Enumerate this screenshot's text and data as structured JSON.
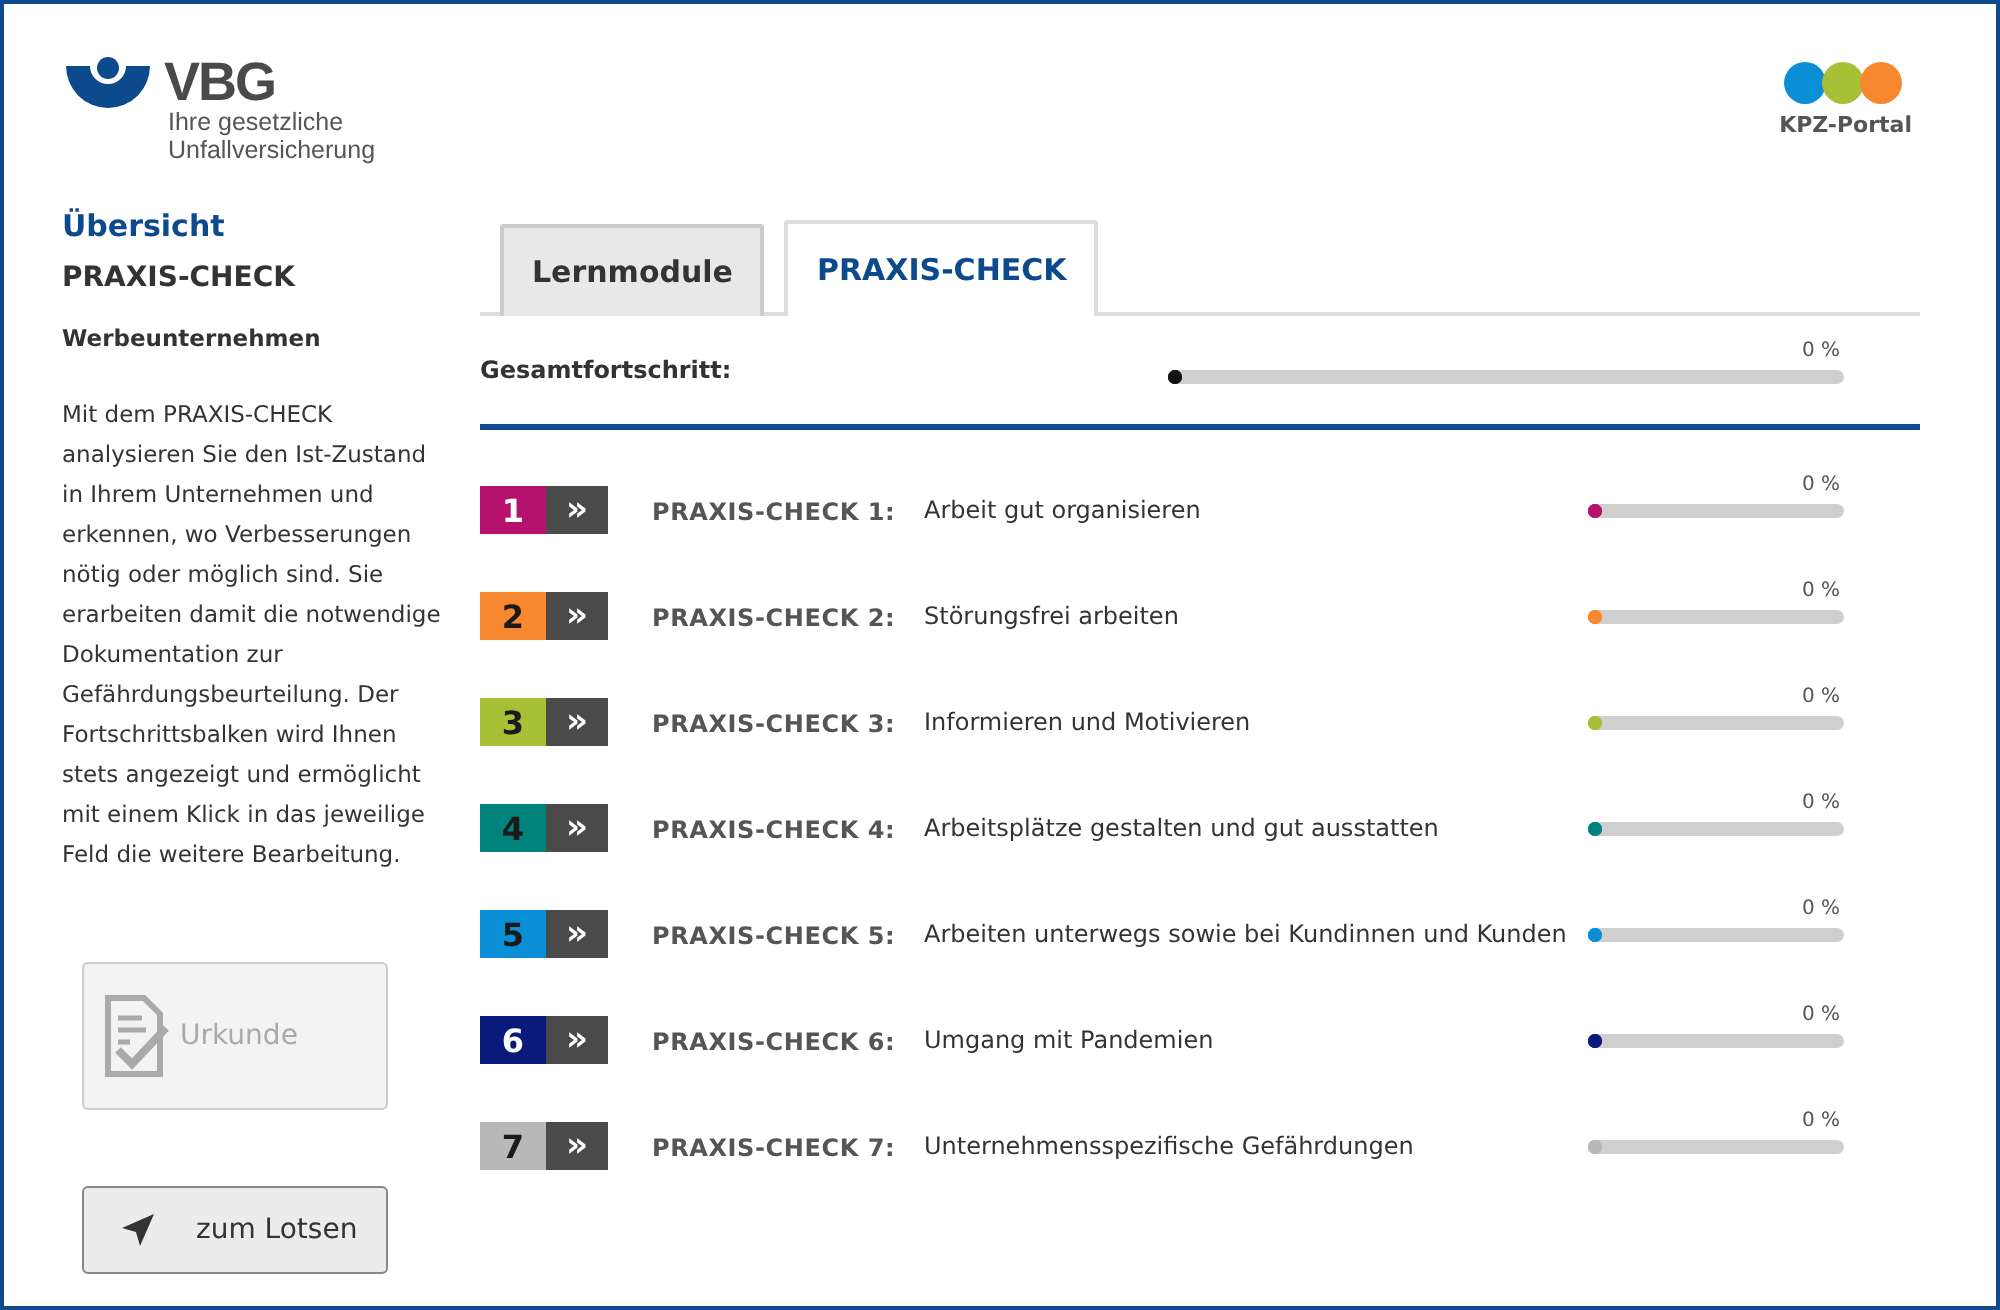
{
  "logo": {
    "name": "VBG",
    "tagline_1": "Ihre gesetzliche",
    "tagline_2": "Unfallversicherung"
  },
  "portal": {
    "label": "KPZ-Portal"
  },
  "sidebar": {
    "heading": "Übersicht",
    "title": "PRAXIS-CHECK",
    "subtitle": "Werbeunternehmen",
    "description": "Mit dem PRAXIS-CHECK analysieren Sie den Ist-Zustand in Ihrem Unternehmen und erkennen, wo Verbesserungen nötig oder möglich sind. Sie erarbeiten damit die notwendige Dokumentation zur Gefährdungsbeurteilung. Der Fortschrittsbalken wird Ihnen stets angezeigt und ermöglicht mit einem Klick in das jeweilige Feld die weitere Bearbeitung.",
    "buttons": [
      {
        "label": "Urkunde",
        "kind": "certificate",
        "disabled": true
      },
      {
        "label": "zum Lotsen",
        "kind": "navigate",
        "disabled": false
      }
    ]
  },
  "tabs": [
    {
      "label": "Lernmodule",
      "selected": false
    },
    {
      "label": "PRAXIS-CHECK",
      "selected": true
    }
  ],
  "overall": {
    "label": "Gesamtfortschritt:",
    "reading": "0 %",
    "level": 0
  },
  "checks": [
    {
      "number": "1",
      "arrow": "»",
      "title": "PRAXIS-CHECK 1:",
      "topic": "Arbeit gut organisieren",
      "reading": "0 %",
      "level": 0,
      "color": "#b5126e",
      "light_number": true
    },
    {
      "number": "2",
      "arrow": "»",
      "title": "PRAXIS-CHECK 2:",
      "topic": "Störungsfrei arbeiten",
      "reading": "0 %",
      "level": 0,
      "color": "#f7882f",
      "light_number": false
    },
    {
      "number": "3",
      "arrow": "»",
      "title": "PRAXIS-CHECK 3:",
      "topic": "Informieren und Motivieren",
      "reading": "0 %",
      "level": 0,
      "color": "#a8c035",
      "light_number": false
    },
    {
      "number": "4",
      "arrow": "»",
      "title": "PRAXIS-CHECK 4:",
      "topic": "Arbeitsplätze gestalten und gut ausstatten",
      "reading": "0 %",
      "level": 0,
      "color": "#00827d",
      "light_number": false
    },
    {
      "number": "5",
      "arrow": "»",
      "title": "PRAXIS-CHECK 5:",
      "topic": "Arbeiten unterwegs sowie bei Kundinnen und Kunden",
      "reading": "0 %",
      "level": 0,
      "color": "#0a8fd6",
      "light_number": false
    },
    {
      "number": "6",
      "arrow": "»",
      "title": "PRAXIS-CHECK 6:",
      "topic": "Umgang mit Pandemien",
      "reading": "0 %",
      "level": 0,
      "color": "#0a1a7a",
      "light_number": true
    },
    {
      "number": "7",
      "arrow": "»",
      "title": "PRAXIS-CHECK 7:",
      "topic": "Unternehmensspezifische Gefährdungen",
      "reading": "0 %",
      "level": 0,
      "color": "#b8b8b8",
      "light_number": false
    }
  ]
}
